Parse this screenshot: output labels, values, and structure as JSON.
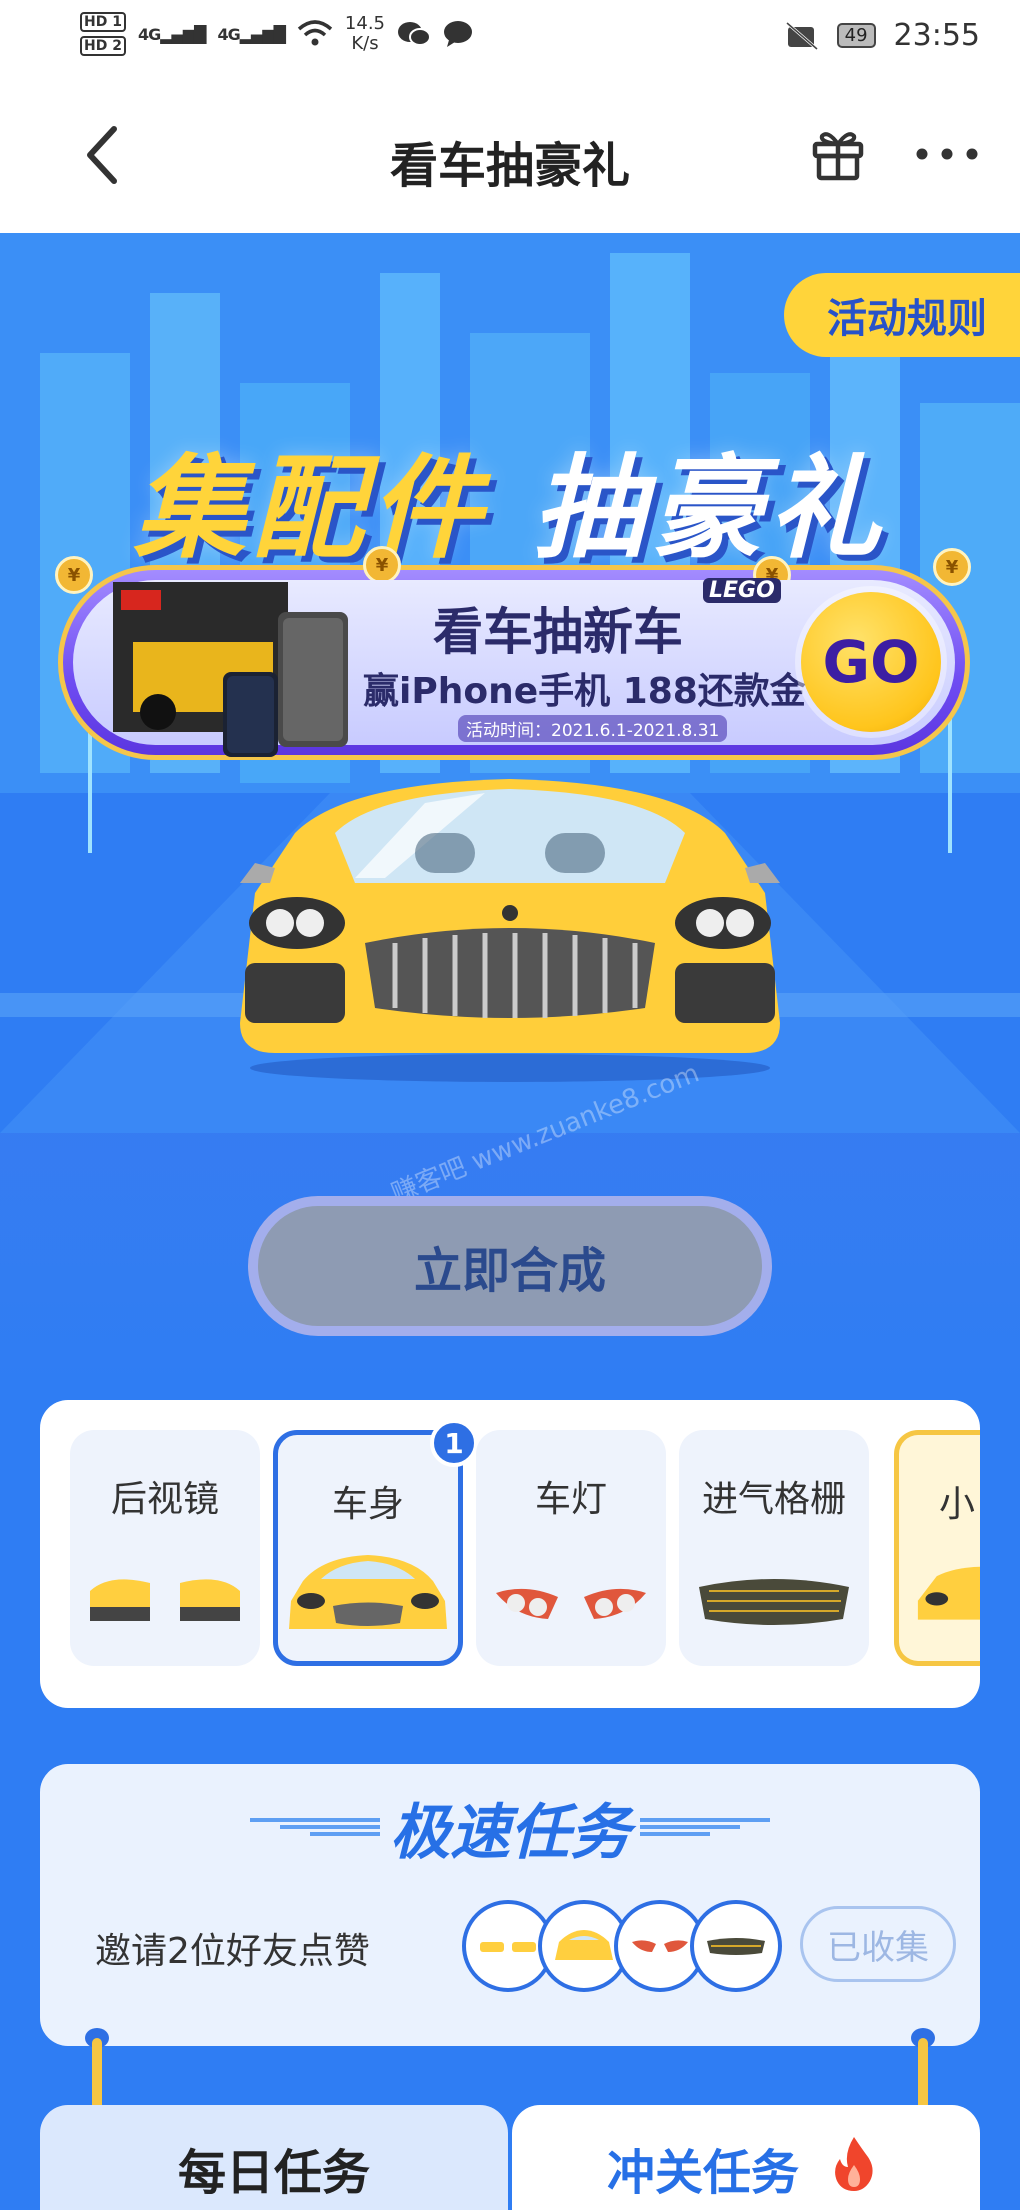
{
  "status_bar": {
    "hd1": "HD 1",
    "hd2": "HD 2",
    "signal1": "4G",
    "signal2": "4G",
    "speed_value": "14.5",
    "speed_unit": "K/s",
    "battery": "49",
    "time": "23:55"
  },
  "nav": {
    "title": "看车抽豪礼"
  },
  "hero": {
    "rules_label": "活动规则",
    "headline_part1": "集配件",
    "headline_part2": "抽豪礼",
    "banner": {
      "title": "看车抽新车",
      "brand": "LEGO",
      "subtitle": "赢iPhone手机 188还款金",
      "period": "活动时间：2021.6.1-2021.8.31",
      "go_label": "GO"
    },
    "watermark": "赚客吧 www.zuanke8.com",
    "synthesize_label": "立即合成"
  },
  "parts": {
    "items": [
      {
        "label": "后视镜",
        "selected": false
      },
      {
        "label": "车身",
        "selected": true,
        "badge": "1"
      },
      {
        "label": "车灯",
        "selected": false
      },
      {
        "label": "进气格栅",
        "selected": false
      },
      {
        "label": "小",
        "selected": false
      }
    ]
  },
  "speed_tasks": {
    "title": "极速任务",
    "task_label": "邀请2位好友点赞",
    "status_label": "已收集"
  },
  "tabs": {
    "daily": "每日任务",
    "level": "冲关任务"
  },
  "colors": {
    "primary_blue": "#2e6fe4",
    "accent_yellow": "#ffd43a",
    "banner_purple": "#6f4cf2"
  }
}
